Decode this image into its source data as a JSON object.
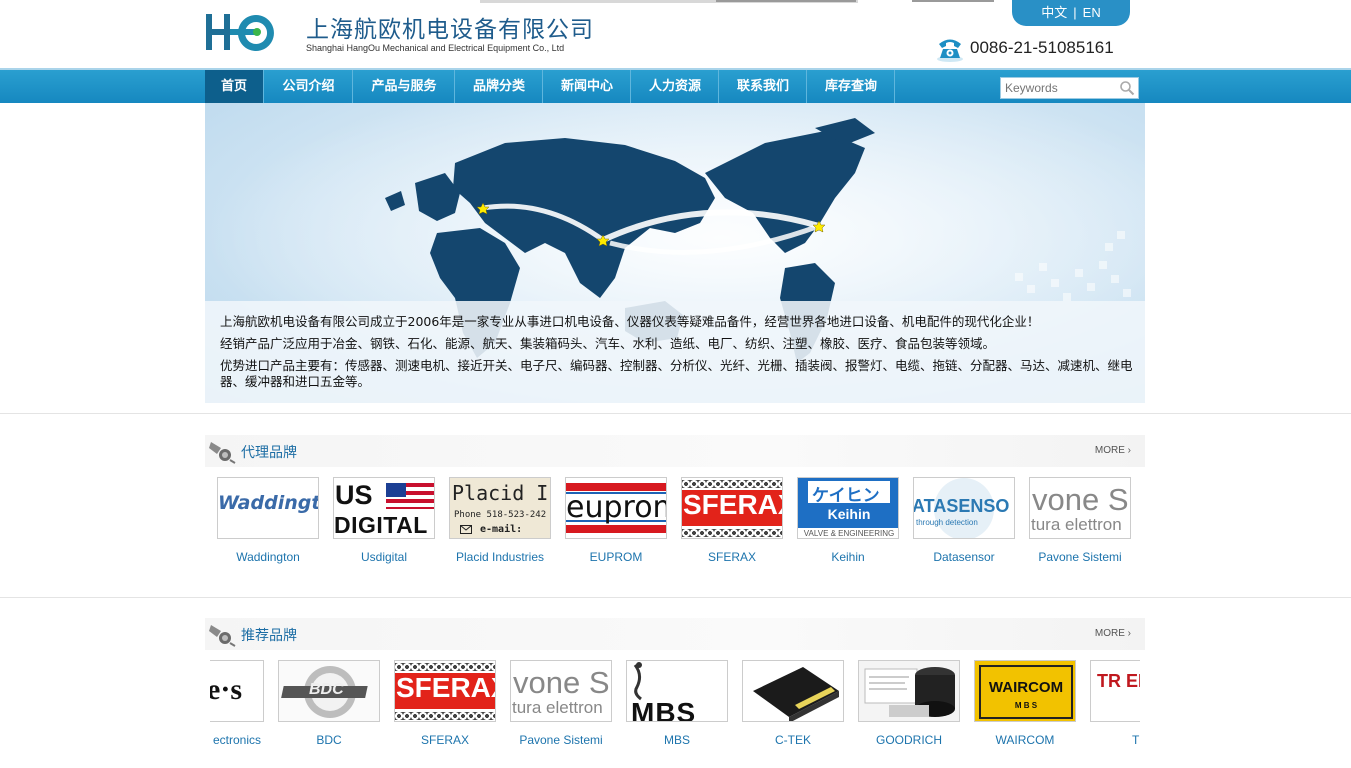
{
  "header": {
    "logo_text": "HO",
    "company_cn": "上海航欧机电设备有限公司",
    "company_en": "Shanghai HangOu Mechanical and Electrical Equipment Co., Ltd",
    "lang_cn": "中文",
    "lang_sep": "|",
    "lang_en": "EN",
    "phone": "0086-21-51085161"
  },
  "nav": {
    "items": [
      "首页",
      "公司介绍",
      "产品与服务",
      "品牌分类",
      "新闻中心",
      "人力资源",
      "联系我们",
      "库存查询"
    ],
    "active_index": 0,
    "search_placeholder": "Keywords"
  },
  "banner": {
    "line1": "上海航欧机电设备有限公司成立于2006年是一家专业从事进口机电设备、仪器仪表等疑难品备件，经营世界各地进口设备、机电配件的现代化企业！",
    "line2": "经销产品广泛应用于冶金、钢铁、石化、能源、航天、集装箱码头、汽车、水利、造纸、电厂、纺织、注塑、橡胶、医疗、食品包装等领域。",
    "line3": "优势进口产品主要有：传感器、测速电机、接近开关、电子尺、编码器、控制器、分析仪、光纤、光栅、插装阀、报警灯、电缆、拖链、分配器、马达、减速机、继电器、缓冲器和进口五金等。"
  },
  "agent_brands": {
    "title": "代理品牌",
    "more": "MORE",
    "items": [
      {
        "name": "Waddington",
        "logo_text": "Waddingto"
      },
      {
        "name": "Usdigital",
        "logo_text_1": "US",
        "logo_text_2": "DIGITAL"
      },
      {
        "name": "Placid Industries",
        "logo_text_1": "Placid In",
        "logo_text_2": "Phone  518-523-242",
        "logo_text_3": "e-mail:"
      },
      {
        "name": "EUPROM",
        "logo_text": "euprom"
      },
      {
        "name": "SFERAX",
        "logo_text": "SFERAX"
      },
      {
        "name": "Keihin",
        "logo_text_1": "ケイヒン",
        "logo_text_2": "Keihin",
        "logo_text_3": "VALVE & ENGINEERING"
      },
      {
        "name": "Datasensor",
        "logo_text_1": "ATASENSO",
        "logo_text_2": "through detection"
      },
      {
        "name": "Pavone Sistemi",
        "logo_text_1": "vone S",
        "logo_text_2": "tura elettron"
      }
    ]
  },
  "recommended_brands": {
    "title": "推荐品牌",
    "more": "MORE",
    "items": [
      {
        "name": "ectronics",
        "logo_text": "e·s"
      },
      {
        "name": "BDC",
        "logo_text": "BDC"
      },
      {
        "name": "SFERAX",
        "logo_text": "SFERAX"
      },
      {
        "name": "Pavone Sistemi",
        "logo_text_1": "vone S",
        "logo_text_2": "tura elettron"
      },
      {
        "name": "MBS",
        "logo_text": "MBS"
      },
      {
        "name": "C-TEK",
        "logo_text": ""
      },
      {
        "name": "GOODRICH",
        "logo_text": ""
      },
      {
        "name": "WAIRCOM",
        "logo_text_1": "WAIRCOM",
        "logo_text_2": "M B S"
      },
      {
        "name": "T",
        "logo_text": "TR EL"
      }
    ]
  },
  "colors": {
    "nav_bg": "#1d95cb",
    "nav_active": "#0d5f8c",
    "brand_link": "#1d74ad",
    "logo_teal": "#1d8aa6"
  }
}
